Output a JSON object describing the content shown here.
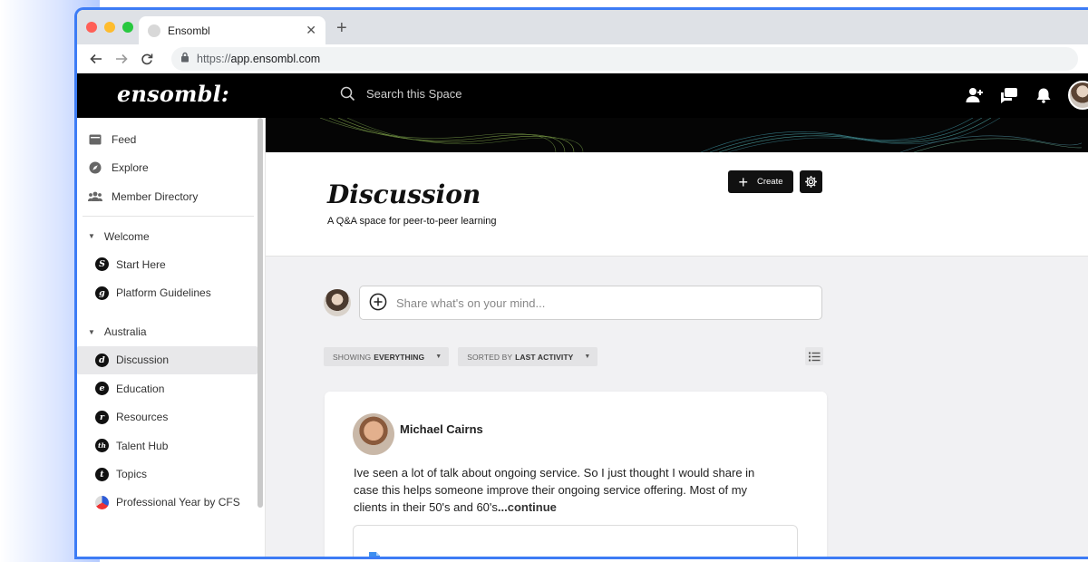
{
  "browser": {
    "tab_title": "Ensombl",
    "url_scheme": "https://",
    "url_host": "app.ensombl.com"
  },
  "header": {
    "logo": "ensombl:",
    "search_placeholder": "Search this Space"
  },
  "sidebar": {
    "top_items": [
      {
        "label": "Feed",
        "icon": "feed-icon"
      },
      {
        "label": "Explore",
        "icon": "compass-icon"
      },
      {
        "label": "Member Directory",
        "icon": "members-icon"
      }
    ],
    "sections": [
      {
        "title": "Welcome",
        "items": [
          {
            "label": "Start Here",
            "badge": "S"
          },
          {
            "label": "Platform Guidelines",
            "badge": "g"
          }
        ]
      },
      {
        "title": "Australia",
        "items": [
          {
            "label": "Discussion",
            "badge": "d",
            "active": true
          },
          {
            "label": "Education",
            "badge": "e"
          },
          {
            "label": "Resources",
            "badge": "r"
          },
          {
            "label": "Talent Hub",
            "badge": "th"
          },
          {
            "label": "Topics",
            "badge": "t"
          },
          {
            "label": "Professional Year by CFS",
            "badge": ""
          }
        ]
      }
    ]
  },
  "space": {
    "title": "Discussion",
    "subtitle": "A Q&A space for peer-to-peer learning",
    "create_label": "Create"
  },
  "composer": {
    "placeholder": "Share what's on your mind..."
  },
  "filters": {
    "showing_prefix": "SHOWING",
    "showing_value": "EVERYTHING",
    "sorted_prefix": "SORTED BY",
    "sorted_value": "LAST ACTIVITY"
  },
  "post": {
    "author": "Michael Cairns",
    "text": "Ive seen a lot of talk about ongoing service. So I just thought I would share in case this helps someone improve their ongoing service offering.  Most of my clients in their 50's and 60's",
    "continue": "...continue"
  },
  "colors": {
    "window_border": "#3d7cf5",
    "header_bg": "#000000",
    "main_bg": "#f1f1f3"
  }
}
